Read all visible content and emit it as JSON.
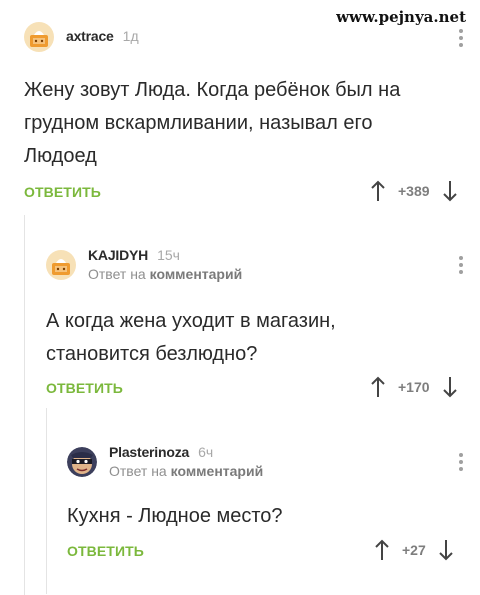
{
  "watermark": "www.pejnya.net",
  "comments": [
    {
      "username": "axtrace",
      "time": "1д",
      "reply_prefix": "",
      "reply_target": "",
      "text_lines": [
        "Жену зовут Люда. Когда ребёнок был на",
        "грудном вскармливании, называл его",
        "Людоед"
      ],
      "reply_label": "ОТВЕТИТЬ",
      "score": "+389",
      "avatar": "pikabu-default-avatar"
    },
    {
      "username": "KAJIDYH",
      "time": "15ч",
      "reply_prefix": "Ответ на ",
      "reply_target": "комментарий",
      "text_lines": [
        "А когда жена уходит в магазин,",
        "становится безлюдно?"
      ],
      "reply_label": "ОТВЕТИТЬ",
      "score": "+170",
      "avatar": "pikabu-default-avatar"
    },
    {
      "username": "Plasterinoza",
      "time": "6ч",
      "reply_prefix": "Ответ на ",
      "reply_target": "комментарий",
      "text_lines": [
        "Кухня - Людное место?"
      ],
      "reply_label": "ОТВЕТИТЬ",
      "score": "+27",
      "avatar": "masked-face-avatar"
    }
  ],
  "colors": {
    "reply": "#7bb83c",
    "time": "#a8a8a8",
    "text": "#2a2a2a"
  },
  "icons": {
    "upvote": "arrow-up-icon",
    "downvote": "arrow-down-icon",
    "menu": "kebab-menu-icon"
  }
}
